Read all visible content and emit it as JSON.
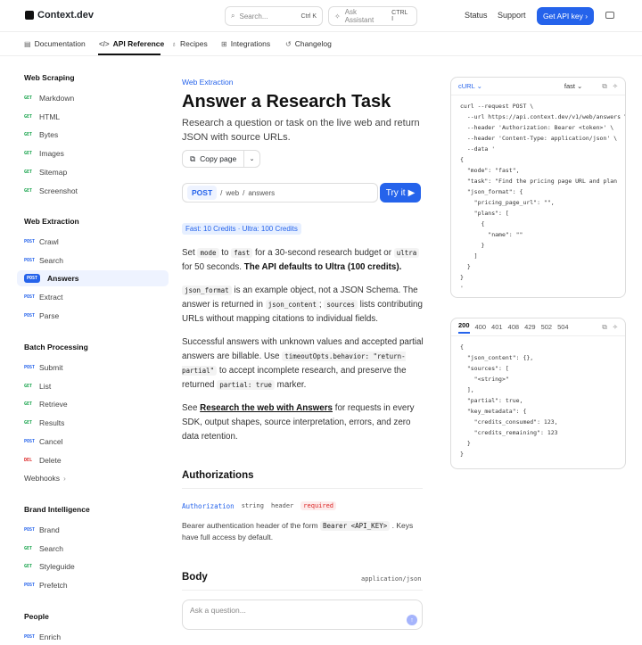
{
  "topbar": {
    "brand": "Context.dev",
    "search_placeholder": "Search...",
    "search_kbd": "Ctrl K",
    "assistant_label": "Ask Assistant",
    "assistant_kbd": "CTRL I",
    "status": "Status",
    "support": "Support",
    "api_key_btn": "Get API key"
  },
  "tabs": [
    "Documentation",
    "API Reference",
    "Recipes",
    "Integrations",
    "Changelog"
  ],
  "sidebar": {
    "sections": [
      {
        "title": "Web Scraping",
        "items": [
          {
            "method": "GET",
            "label": "Markdown"
          },
          {
            "method": "GET",
            "label": "HTML"
          },
          {
            "method": "GET",
            "label": "Bytes"
          },
          {
            "method": "GET",
            "label": "Images"
          },
          {
            "method": "GET",
            "label": "Sitemap"
          },
          {
            "method": "GET",
            "label": "Screenshot"
          }
        ]
      },
      {
        "title": "Web Extraction",
        "items": [
          {
            "method": "POST",
            "label": "Crawl"
          },
          {
            "method": "POST",
            "label": "Search"
          },
          {
            "method": "POST",
            "label": "Answers"
          },
          {
            "method": "POST",
            "label": "Extract"
          },
          {
            "method": "POST",
            "label": "Parse"
          }
        ]
      },
      {
        "title": "Batch Processing",
        "items": [
          {
            "method": "POST",
            "label": "Submit"
          },
          {
            "method": "GET",
            "label": "List"
          },
          {
            "method": "GET",
            "label": "Retrieve"
          },
          {
            "method": "GET",
            "label": "Results"
          },
          {
            "method": "POST",
            "label": "Cancel"
          },
          {
            "method": "DEL",
            "label": "Delete"
          },
          {
            "method": "",
            "label": "Webhooks"
          }
        ]
      },
      {
        "title": "Brand Intelligence",
        "items": [
          {
            "method": "POST",
            "label": "Brand"
          },
          {
            "method": "GET",
            "label": "Search"
          },
          {
            "method": "GET",
            "label": "Styleguide"
          },
          {
            "method": "POST",
            "label": "Prefetch"
          }
        ]
      },
      {
        "title": "People",
        "items": [
          {
            "method": "POST",
            "label": "Enrich"
          }
        ]
      }
    ]
  },
  "main": {
    "eyebrow": "Web Extraction",
    "title": "Answer a Research Task",
    "subtitle": "Research a question or task on the live web and return JSON with source URLs.",
    "copy_page": "Copy page",
    "endpoint_method": "POST",
    "endpoint_path_1": "web",
    "endpoint_path_2": "answers",
    "try_it": "Try it",
    "credits": "Fast: 10 Credits · Ultra: 100 Credits",
    "p1_a": "Set",
    "p1_mode": "mode",
    "p1_b": "to",
    "p1_fast": "fast",
    "p1_c": "for a 30-second research budget or",
    "p1_ultra": "ultra",
    "p1_d": "for 50 seconds.",
    "p1_bold": "The API defaults to Ultra (100 credits).",
    "p2_code1": "json_format",
    "p2_a": "is an example object, not a JSON Schema. The answer is returned in",
    "p2_code2": "json_content",
    "p2_semi": ";",
    "p2_code3": "sources",
    "p2_b": "lists contributing URLs without mapping citations to individual fields.",
    "p3_a": "Successful answers with unknown values and accepted partial answers are billable. Use",
    "p3_code1": "timeoutOpts.behavior: \"return-partial\"",
    "p3_b": "to accept incomplete research, and preserve the returned",
    "p3_code2": "partial: true",
    "p3_c": "marker.",
    "p4_a": "See",
    "p4_link": "Research the web with Answers",
    "p4_b": "for requests in every SDK, output shapes, source interpretation, errors, and zero data retention.",
    "auth_heading": "Authorizations",
    "param_name": "Authorization",
    "param_type": "string",
    "param_loc": "header",
    "param_req": "required",
    "param_desc_a": "Bearer authentication header of the form",
    "param_desc_code": "Bearer <API_KEY>",
    "param_desc_b": ". Keys have full access by default.",
    "body_heading": "Body",
    "content_type": "application/json",
    "ask_placeholder": "Ask a question..."
  },
  "request_panel": {
    "lang": "cURL",
    "variant": "fast",
    "code": "curl --request POST \\\n  --url https://api.context.dev/v1/web/answers \\\n  --header 'Authorization: Bearer <token>' \\\n  --header 'Content-Type: application/json' \\\n  --data '\n{\n  \"mode\": \"fast\",\n  \"task\": \"Find the pricing page URL and plan\n  \"json_format\": {\n    \"pricing_page_url\": \"\",\n    \"plans\": [\n      {\n        \"name\": \"\"\n      }\n    ]\n  }\n}\n'"
  },
  "response_panel": {
    "codes": [
      "200",
      "400",
      "401",
      "408",
      "429",
      "502",
      "504"
    ],
    "code": "{\n  \"json_content\": {},\n  \"sources\": [\n    \"<string>\"\n  ],\n  \"partial\": true,\n  \"key_metadata\": {\n    \"credits_consumed\": 123,\n    \"credits_remaining\": 123\n  }\n}"
  }
}
